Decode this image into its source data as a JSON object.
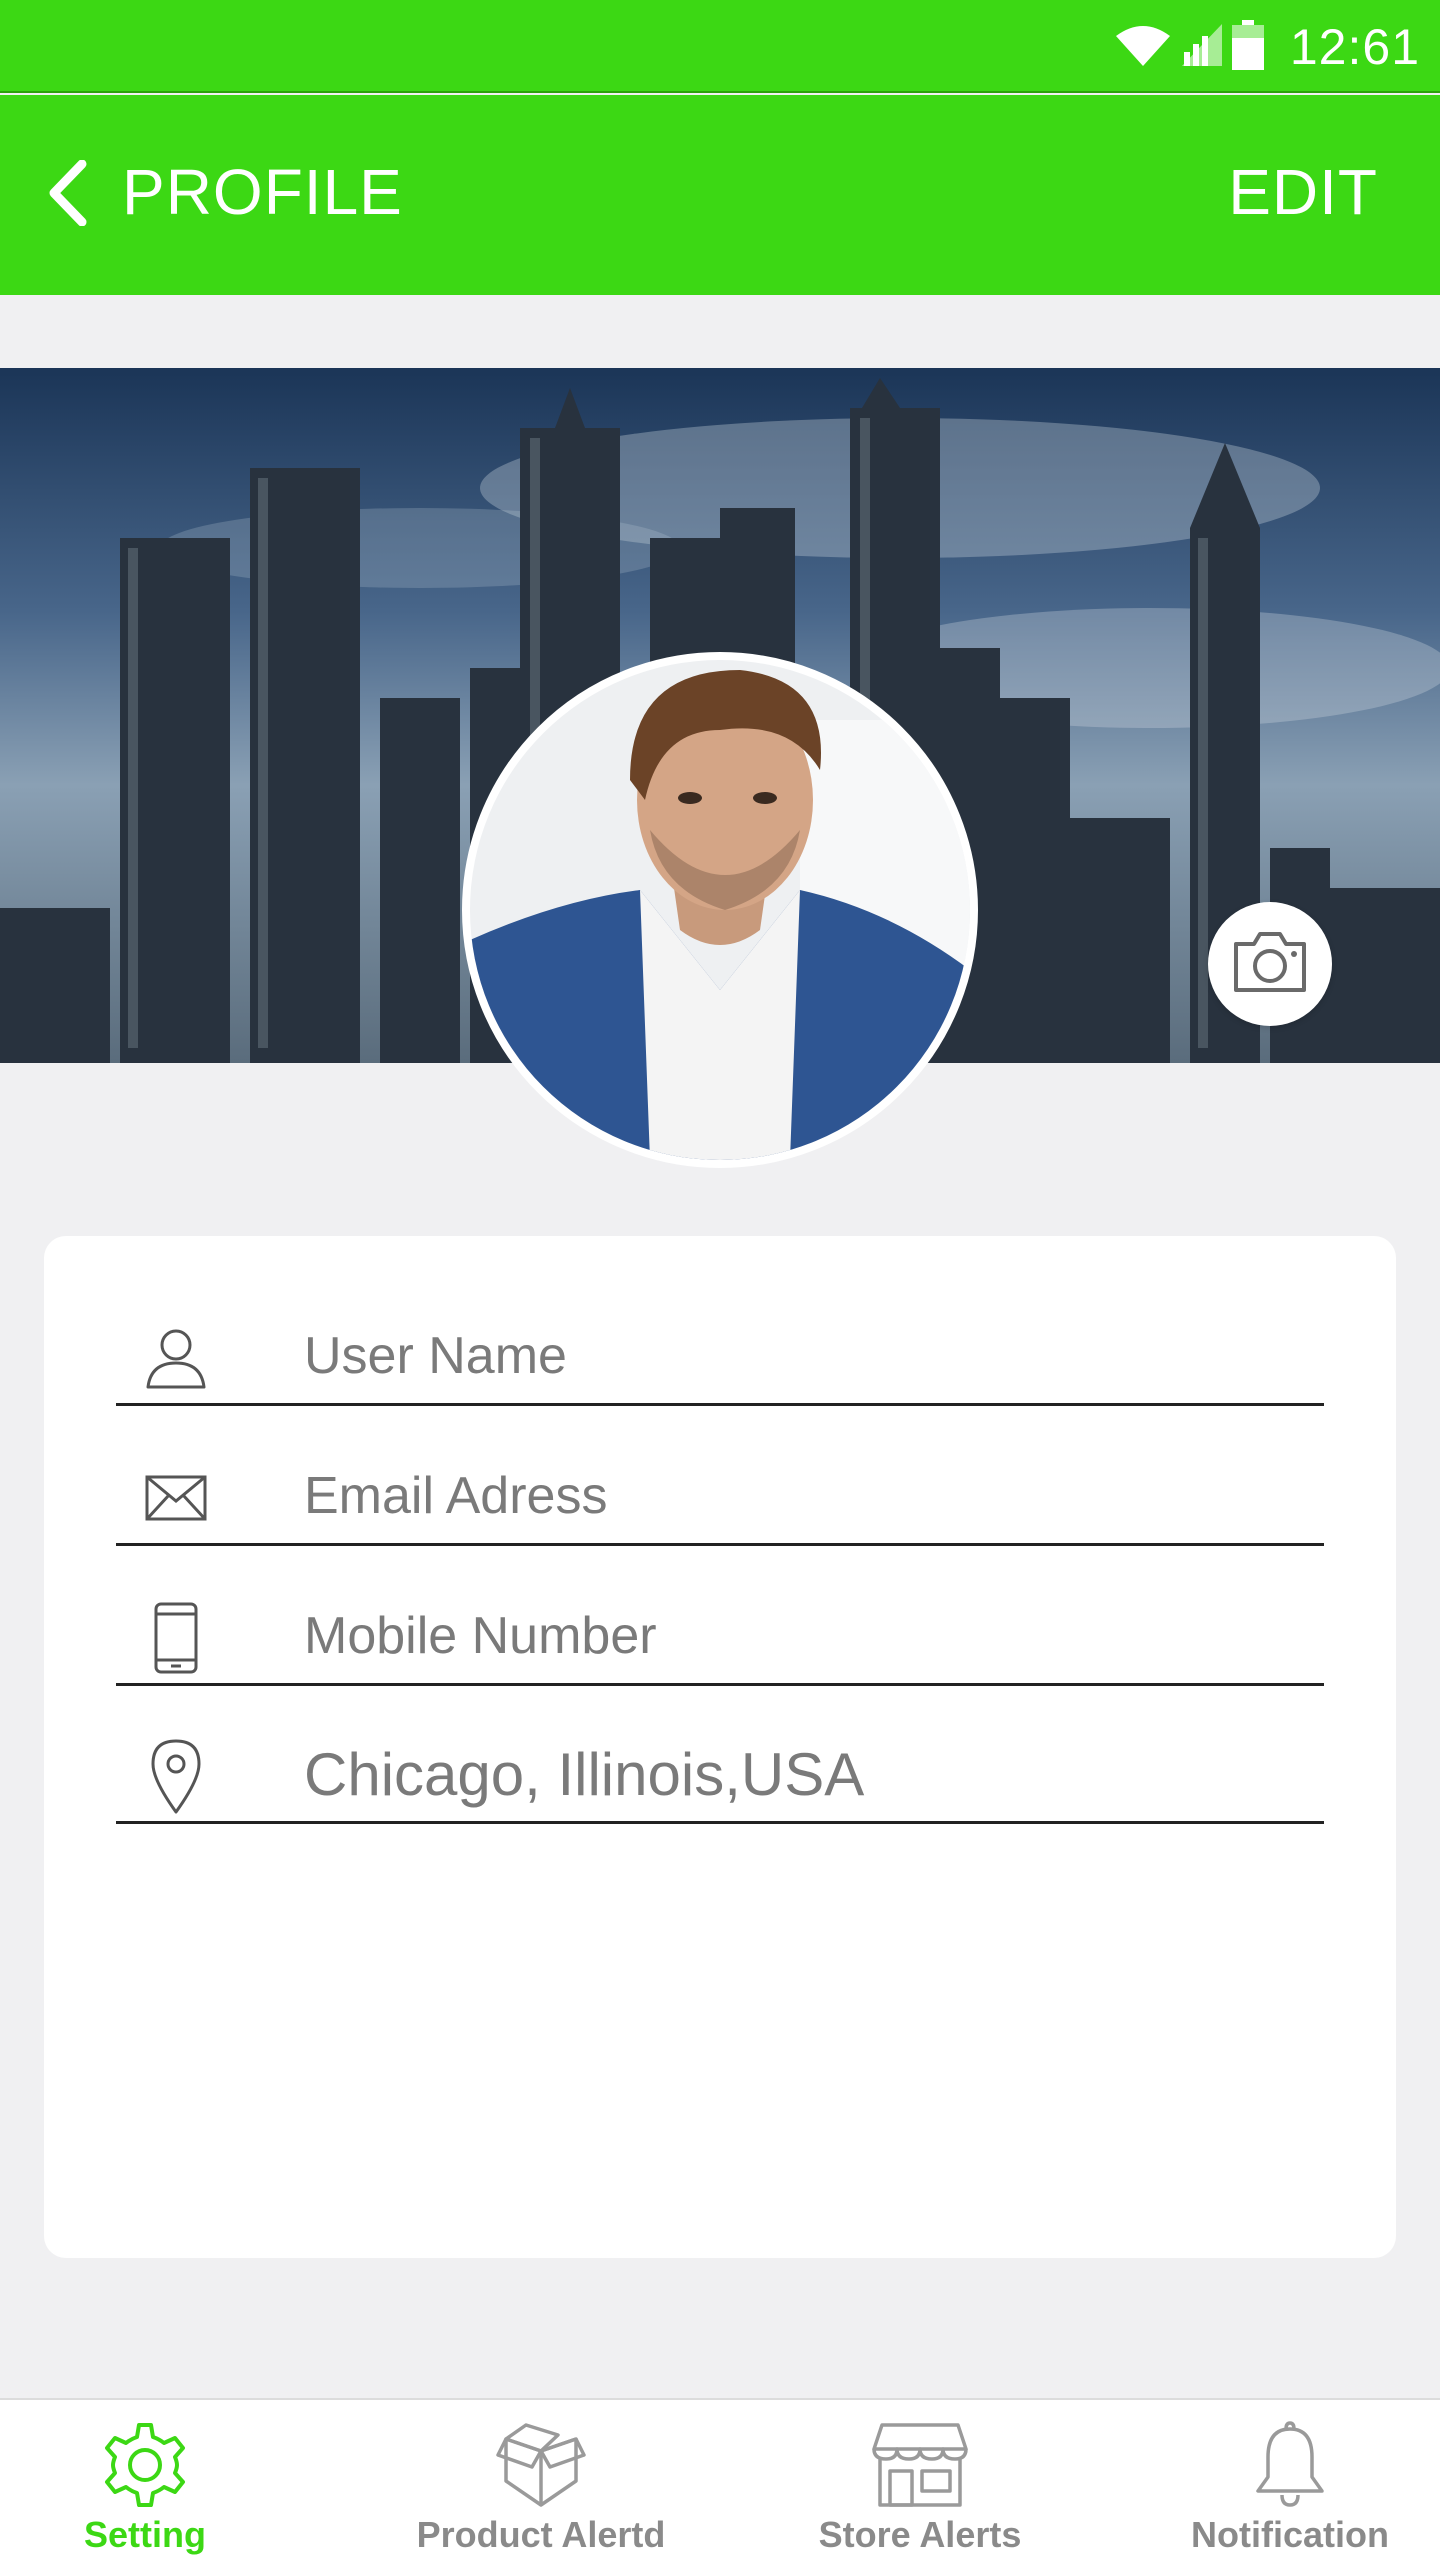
{
  "status_bar": {
    "time": "12:61",
    "icons": [
      "wifi-icon",
      "signal-icon",
      "battery-icon"
    ]
  },
  "app_bar": {
    "title": "PROFILE",
    "back_icon": "chevron-left-icon",
    "edit_label": "EDIT"
  },
  "cover": {
    "camera_icon": "camera-icon"
  },
  "form": {
    "user_name": {
      "placeholder": "User Name",
      "icon": "user-icon"
    },
    "email": {
      "placeholder": "Email Adress",
      "icon": "envelope-icon"
    },
    "mobile": {
      "placeholder": "Mobile Number",
      "icon": "phone-icon"
    },
    "location": {
      "value": "Chicago, Illinois,USA",
      "icon": "location-pin-icon"
    }
  },
  "bottom_nav": {
    "items": [
      {
        "label": "Setting",
        "icon": "gear-icon",
        "active": true
      },
      {
        "label": "Product Alertd",
        "icon": "box-icon",
        "active": false
      },
      {
        "label": "Store Alerts",
        "icon": "store-icon",
        "active": false
      },
      {
        "label": "Notification",
        "icon": "bell-icon",
        "active": false
      }
    ]
  },
  "colors": {
    "brand_green": "#3cd814",
    "inactive_gray": "#8a8a8a",
    "background": "#f0f0f2"
  }
}
